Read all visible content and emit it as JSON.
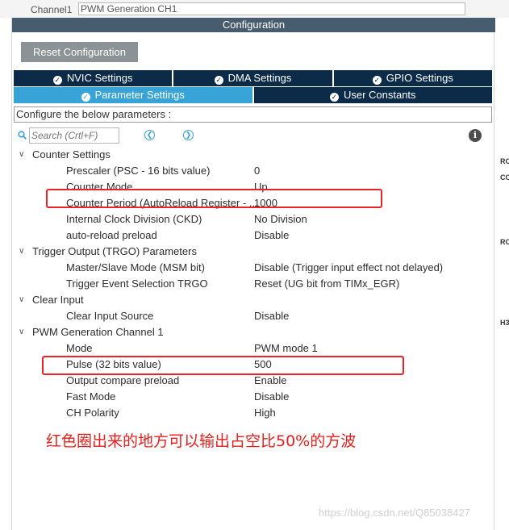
{
  "top_strip": {
    "label": "Channel1",
    "value": "PWM Generation CH1"
  },
  "window": {
    "title": "Configuration"
  },
  "reset_button": "Reset Configuration",
  "tabs_row1": [
    {
      "label": "NVIC Settings",
      "icon": "check-circle-icon"
    },
    {
      "label": "DMA Settings",
      "icon": "check-circle-icon"
    },
    {
      "label": "GPIO Settings",
      "icon": "check-circle-icon"
    }
  ],
  "tabs_row2": [
    {
      "label": "Parameter Settings",
      "icon": "check-circle-icon",
      "active": true
    },
    {
      "label": "User Constants",
      "icon": "check-circle-icon",
      "active": false
    }
  ],
  "configure_text": "Configure the below parameters :",
  "search": {
    "placeholder": "Search (Crtl+F)",
    "prev_icon": "chevron-left-circle-icon",
    "next_icon": "chevron-right-circle-icon",
    "info_icon": "info-icon"
  },
  "groups": [
    {
      "name": "Counter Settings",
      "params": [
        {
          "name": "Prescaler (PSC - 16 bits value)",
          "value": "0"
        },
        {
          "name": "Counter Mode",
          "value": "Up"
        },
        {
          "name": "Counter Period (AutoReload Register - ...",
          "value": "1000"
        },
        {
          "name": "Internal Clock Division (CKD)",
          "value": "No Division"
        },
        {
          "name": "auto-reload preload",
          "value": "Disable"
        }
      ]
    },
    {
      "name": "Trigger Output (TRGO) Parameters",
      "params": [
        {
          "name": "Master/Slave Mode (MSM bit)",
          "value": "Disable (Trigger input effect not delayed)"
        },
        {
          "name": "Trigger Event Selection TRGO",
          "value": "Reset (UG bit from TIMx_EGR)"
        }
      ]
    },
    {
      "name": "Clear Input",
      "params": [
        {
          "name": "Clear Input Source",
          "value": "Disable"
        }
      ]
    },
    {
      "name": "PWM Generation Channel 1",
      "params": [
        {
          "name": "Mode",
          "value": "PWM mode 1"
        },
        {
          "name": "Pulse (32 bits value)",
          "value": "500"
        },
        {
          "name": "Output compare preload",
          "value": "Enable"
        },
        {
          "name": "Fast Mode",
          "value": "Disable"
        },
        {
          "name": "CH Polarity",
          "value": "High"
        }
      ]
    }
  ],
  "annotation_note": "红色圈出来的地方可以输出占空比50%的方波",
  "watermark": "https://blog.csdn.net/Q85038427",
  "right_edge_labels": [
    "RC",
    "CO",
    "RC",
    "H3"
  ],
  "colors": {
    "title_bar": "#475c6e",
    "tab_dark": "#0c2b49",
    "tab_active": "#37a3d6",
    "highlight_red": "#e8242a"
  }
}
